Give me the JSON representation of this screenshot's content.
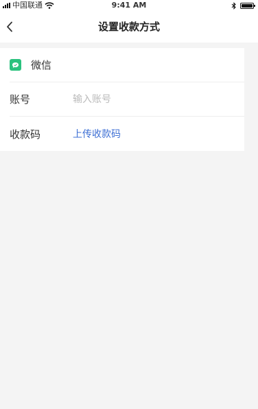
{
  "status_bar": {
    "carrier": "中国联通",
    "time": "9:41 AM",
    "icons": [
      "signal-icon",
      "wifi-icon",
      "bluetooth-icon",
      "battery-icon"
    ]
  },
  "nav": {
    "title": "设置收款方式",
    "back_icon": "chevron-left-icon"
  },
  "form": {
    "method": {
      "icon": "wechat-pay-icon",
      "name": "微信",
      "icon_color": "#2bc27e"
    },
    "account": {
      "label": "账号",
      "value": "",
      "placeholder": "输入账号"
    },
    "qr_code": {
      "label": "收款码",
      "action": "上传收款码",
      "action_color": "#3d6fd4"
    }
  }
}
